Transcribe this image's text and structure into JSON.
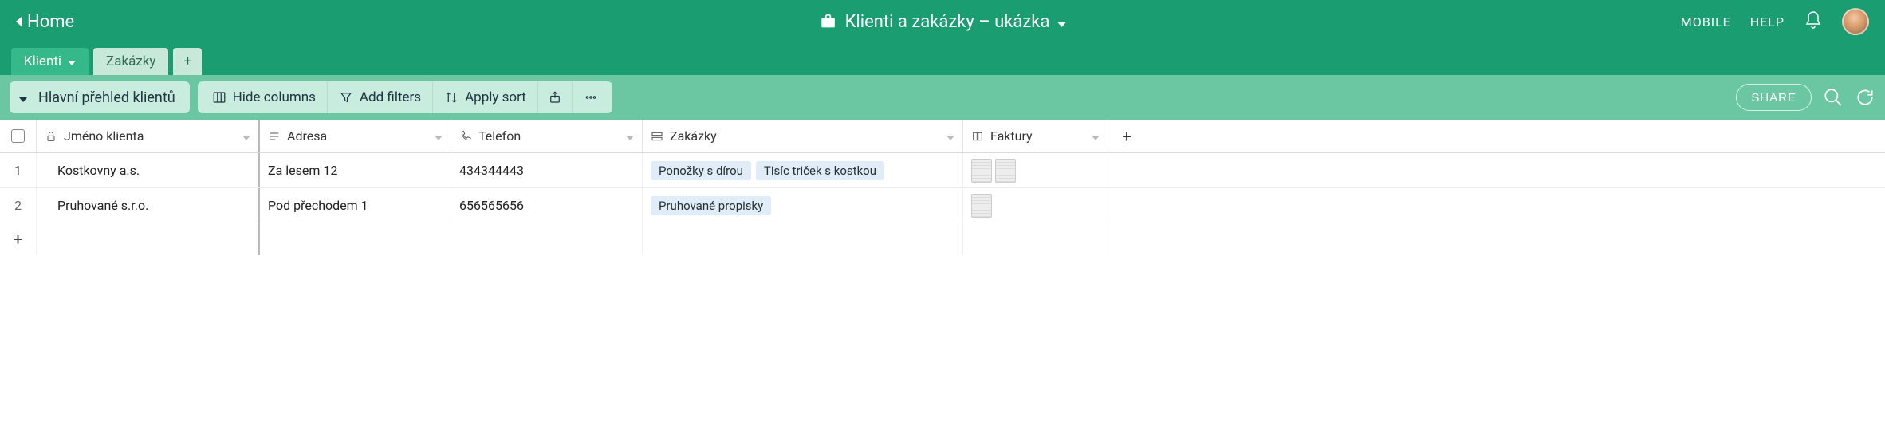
{
  "topbar": {
    "home_label": "Home",
    "app_title": "Klienti a zakázky – ukázka",
    "mobile_label": "MOBILE",
    "help_label": "HELP"
  },
  "tabs": {
    "active": "Klienti",
    "inactive": "Zakázky"
  },
  "toolbar": {
    "view_name": "Hlavní přehled klientů",
    "hide_columns": "Hide columns",
    "add_filters": "Add filters",
    "apply_sort": "Apply sort",
    "share_label": "SHARE"
  },
  "columns": {
    "name": "Jméno klienta",
    "address": "Adresa",
    "phone": "Telefon",
    "orders": "Zakázky",
    "invoices": "Faktury"
  },
  "rows": [
    {
      "num": "1",
      "name": "Kostkovny a.s.",
      "address": "Za lesem 12",
      "phone": "434344443",
      "orders": [
        "Ponožky s dírou",
        "Tisíc triček s kostkou"
      ],
      "invoices": 2
    },
    {
      "num": "2",
      "name": "Pruhované s.r.o.",
      "address": "Pod přechodem 1",
      "phone": "656565656",
      "orders": [
        "Pruhované propisky"
      ],
      "invoices": 1
    }
  ],
  "add_row_symbol": "+",
  "add_col_symbol": "+"
}
